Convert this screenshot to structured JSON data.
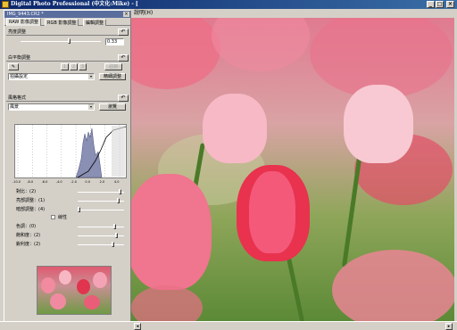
{
  "window": {
    "title": "Digital Photo Professional (中文化:Mike) - ["
  },
  "menu": {
    "help": "說明(H)"
  },
  "palette": {
    "title": "IMG_9443.CR2 *",
    "close_glyph": "×",
    "tabs": [
      "RAW 影像調整",
      "RGB 影像調整",
      "編輯調整"
    ]
  },
  "brightness": {
    "header": "亮度調整",
    "value": "0.33",
    "reset_glyph": "↶"
  },
  "white_balance": {
    "header": "白平衡調整",
    "reset_glyph": "↶",
    "eyedropper_glyph": "✎",
    "mode_value": "拍攝設定",
    "adjust_button": "精細調整",
    "save_buttons": [
      "1",
      "2",
      "3"
    ],
    "register_button": "註冊"
  },
  "picture_style": {
    "header": "風格格式",
    "reset_glyph": "↶",
    "style_value": "風景",
    "browse_button": "瀏覽",
    "axis_ticks": [
      "-10.0",
      "-8.0",
      "-6.0",
      "-4.0",
      "-2.0",
      "0.0",
      "2.0",
      "4.0"
    ],
    "contrast_label": "對比：(2)",
    "highlight_label": "亮部調整：(1)",
    "shadow_label": "暗部調整：(4)",
    "linear_label": "線性",
    "tone_label": "色調：(0)",
    "saturation_label": "飽和度：(2)",
    "sharpness_label": "銳利度：(2)",
    "dotted_marks": [
      -10,
      -8,
      -6,
      -4,
      -2,
      0,
      2,
      4
    ]
  },
  "status": {
    "left_arrow": "◂",
    "right_arrow": "▸"
  }
}
